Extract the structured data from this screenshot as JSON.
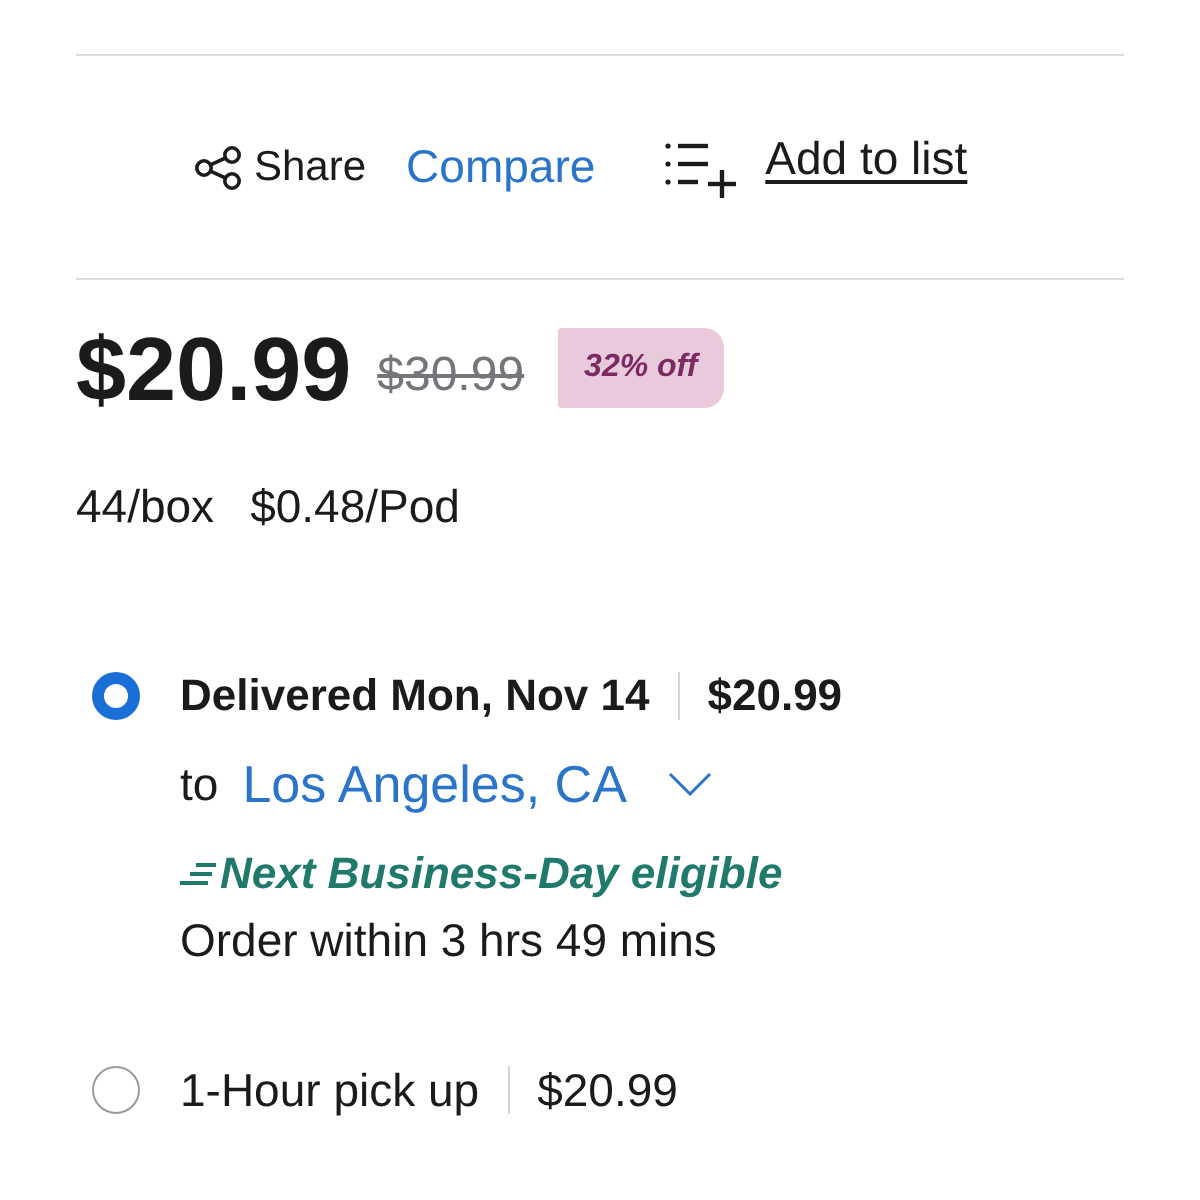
{
  "actions": [
    {
      "kind": "share",
      "label": "Share"
    },
    {
      "kind": "compare",
      "label": "Compare"
    },
    {
      "kind": "add_to_list",
      "label": "Add to list"
    }
  ],
  "price": {
    "current": "$20.99",
    "was": "$30.99",
    "discount_badge": "32% off"
  },
  "unit_info": [
    "44/box",
    "$0.48/Pod"
  ],
  "fulfillment_options": [
    {
      "kind": "delivery",
      "label": "Delivered Mon, Nov 14",
      "price": "$20.99",
      "selected": true,
      "destination_prefix": "to",
      "destination": "Los Angeles, CA",
      "eligibility": "Next Business-Day eligible",
      "cutoff": "Order within 3 hrs 49 mins"
    },
    {
      "kind": "pickup",
      "label": "1-Hour pick up",
      "price": "$20.99",
      "selected": false
    }
  ]
}
